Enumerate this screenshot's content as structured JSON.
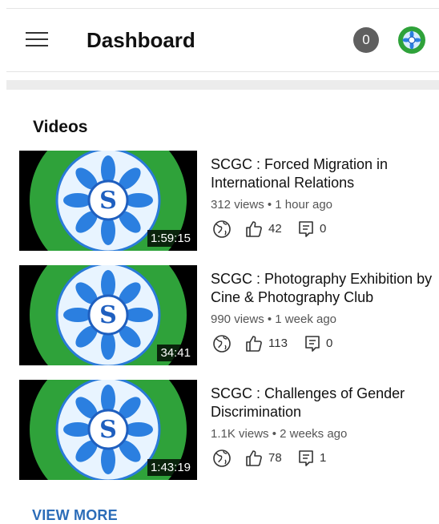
{
  "header": {
    "title": "Dashboard",
    "notification_count": "0"
  },
  "section": {
    "title": "Videos"
  },
  "videos": [
    {
      "title": "SCGC : Forced Migration in International Relations",
      "views": "312 views",
      "time": "1 hour ago",
      "duration": "1:59:15",
      "likes": "42",
      "comments": "0"
    },
    {
      "title": "SCGC : Photography Exhibition by Cine & Photography Club",
      "views": "990 views",
      "time": "1 week ago",
      "duration": "34:41",
      "likes": "113",
      "comments": "0"
    },
    {
      "title": "SCGC : Challenges of Gender Discrimination",
      "views": "1.1K views",
      "time": "2 weeks ago",
      "duration": "1:43:19",
      "likes": "78",
      "comments": "1"
    }
  ],
  "actions": {
    "view_more": "VIEW MORE"
  },
  "colors": {
    "accent": "#2b6cb8",
    "logo_green": "#2fa23a",
    "logo_blue": "#1f5fbf"
  },
  "icons": [
    "menu-icon",
    "globe-icon",
    "thumbs-up-icon",
    "comment-icon"
  ]
}
